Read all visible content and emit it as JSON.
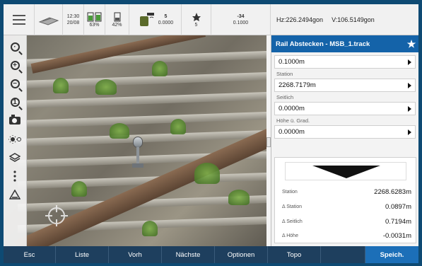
{
  "status": {
    "time": "12:30",
    "date": "20/08",
    "battery1": "63%",
    "battery2": "42%",
    "gnss_sats": "5",
    "gnss_value": "0.0000",
    "prism_num": "-34",
    "prism_sats": "5",
    "prism_value": "0.1000",
    "hz": "Hz:226.2494gon",
    "v": "V:106.5149gon"
  },
  "panel": {
    "title": "Rail Abstecken - MSB_1.track",
    "fields": [
      {
        "label": "",
        "value": "0.1000m"
      },
      {
        "label": "Station",
        "value": "2268.7179m"
      },
      {
        "label": "Seitlich",
        "value": "0.0000m"
      },
      {
        "label": "Höhe ü. Grad.",
        "value": "0.0000m"
      }
    ],
    "results": [
      {
        "label": "Station",
        "value": "2268.6283m"
      },
      {
        "label": "Δ Station",
        "value": "0.0897m"
      },
      {
        "label": "Δ Seitlich",
        "value": "0.7194m"
      },
      {
        "label": "Δ Höhe",
        "value": "-0.0031m"
      }
    ]
  },
  "toolbar": {
    "icons": [
      "zoom-fit-icon",
      "zoom-in-icon",
      "zoom-out-icon",
      "zoom-reset-icon",
      "camera-icon",
      "brightness-icon",
      "layers-icon",
      "more-icon",
      "warning-icon"
    ]
  },
  "bottom_buttons": [
    "Esc",
    "Liste",
    "Vorh",
    "Nächste",
    "Optionen",
    "Topo",
    "Speich."
  ],
  "colors": {
    "accent": "#1463a9",
    "bottombar": "#1e3f5e",
    "save": "#1c6fb8"
  }
}
